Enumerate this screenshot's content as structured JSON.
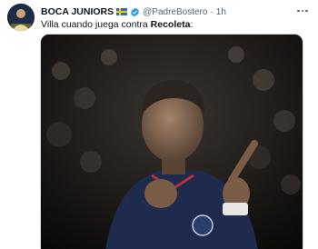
{
  "tweet": {
    "author_name": "BOCA JUNIORS",
    "flag_icon": "sweden-flag-icon",
    "verified_icon": "verified-badge-icon",
    "verified_color": "#1d9bf0",
    "handle": "@PadreBostero",
    "separator": "·",
    "time": "1h",
    "text_prefix": "Villa cuando juega contra ",
    "text_bold": "Recoleta",
    "text_suffix": ":",
    "more_icon": "more-options-icon"
  }
}
